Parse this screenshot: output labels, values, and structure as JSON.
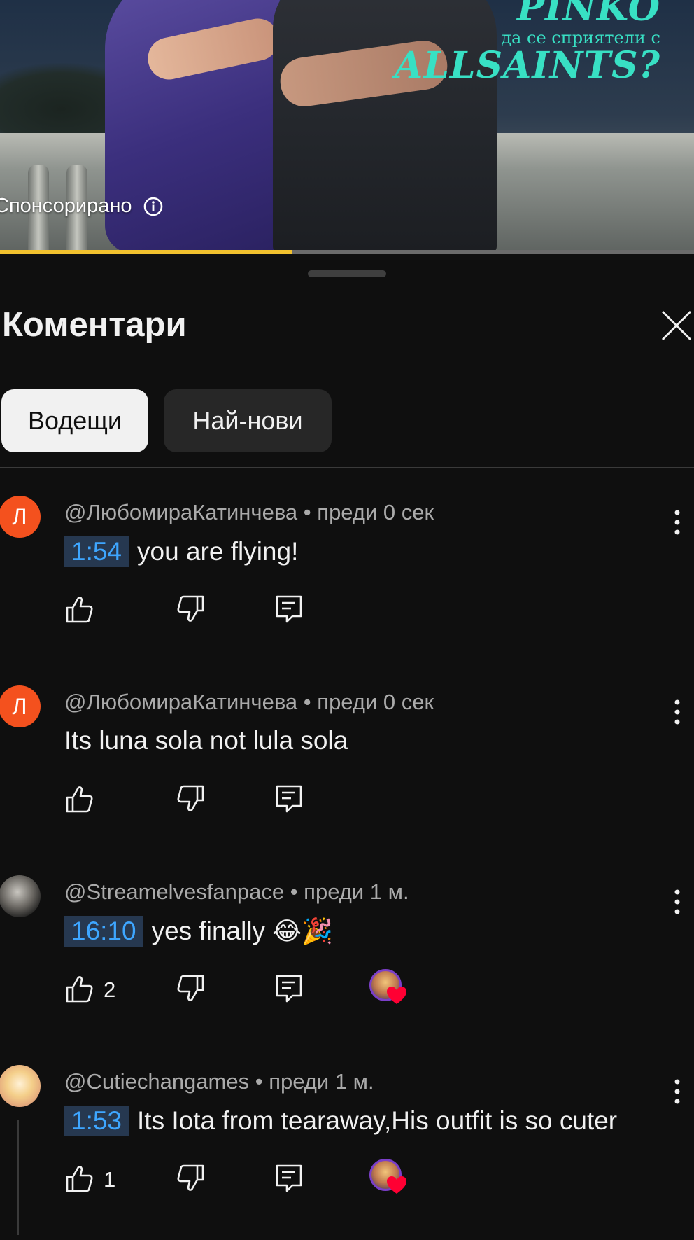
{
  "ad": {
    "title_line1": "PINKO",
    "title_line2": "да се сприятели с",
    "title_line3": "ALLSAINTS?",
    "sponsored_label": "Спонсорирано",
    "progress_fraction": 0.42,
    "progress_color": "#f2c12e",
    "title_color": "#38e0c4"
  },
  "sheet": {
    "title": "Коментари",
    "close_icon": "close-icon"
  },
  "chips": [
    {
      "label": "Водещи",
      "selected": true
    },
    {
      "label": "Най-нови",
      "selected": false
    }
  ],
  "comments": [
    {
      "avatar_letter": "Л",
      "author": "@ЛюбомираКатинчева",
      "time": "преди 0 сек",
      "timestamp": "1:54",
      "text": "you are flying!",
      "likes": ""
    },
    {
      "avatar_letter": "Л",
      "author": "@ЛюбомираКатинчева",
      "time": "преди 0 сек",
      "timestamp": "",
      "text": "Its luna sola not lula sola",
      "likes": ""
    },
    {
      "avatar_letter": "",
      "author": "@Streamelvesfanpace",
      "time": "преди 1 м.",
      "timestamp": "16:10",
      "text": "yes finally",
      "emoji": "😂🎉",
      "likes": "2",
      "creator_hearted": true
    },
    {
      "avatar_letter": "",
      "author": "@Cutiechangames",
      "time": "преди 1 м.",
      "timestamp": "1:53",
      "text": "Its Iota from tearaway,His outfit is so cuter",
      "likes": "1",
      "creator_hearted": true
    }
  ],
  "separator": " • ",
  "colors": {
    "background": "#0f0f0f",
    "timestamp_text": "#3ea6ff",
    "timestamp_bg": "#263850",
    "avatar_orange": "#f4511e",
    "heart": "#ff0033"
  }
}
